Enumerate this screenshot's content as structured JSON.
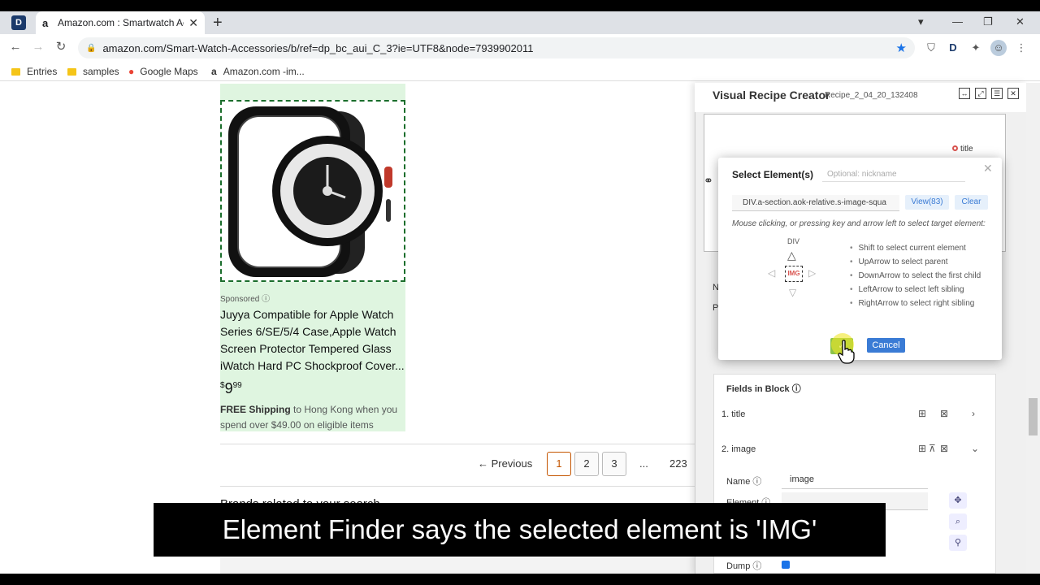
{
  "browser": {
    "tab_title": "Amazon.com : Smartwatch Ac",
    "tab_favicon": "a",
    "url": "amazon.com/Smart-Watch-Accessories/b/ref=dp_bc_aui_C_3?ie=UTF8&node=7939902011",
    "bookmarks": [
      {
        "label": "Entries",
        "icon": "folder-icon"
      },
      {
        "label": "samples",
        "icon": "folder-icon"
      },
      {
        "label": "Google Maps",
        "icon": "map-pin-icon"
      },
      {
        "label": "Amazon.com -im...",
        "icon": "amazon-icon"
      }
    ]
  },
  "product": {
    "sponsored": "Sponsored",
    "title": "Juyya Compatible for Apple Watch Series 6/SE/5/4 Case,Apple Watch Screen Protector Tempered Glass iWatch Hard PC Shockproof Cover...",
    "price_symbol": "$",
    "price_whole": "9",
    "price_fraction": "99",
    "shipping_bold": "FREE Shipping",
    "shipping_rest": " to Hong Kong when you spend over $49.00 on eligible items"
  },
  "pagination": {
    "previous": "← Previous",
    "pages": [
      "1",
      "2",
      "3"
    ],
    "ellipsis": "...",
    "last": "223"
  },
  "page": {
    "brands_heading": "Brands related to your search"
  },
  "recipe_panel": {
    "title": "Visual Recipe Creator",
    "subtitle": "Recipe_2_04_20_132408",
    "diagram_node": "title",
    "fields_heading": "Fields in Block",
    "fields": [
      {
        "label": "1. title"
      },
      {
        "label": "2. image"
      }
    ],
    "name_label": "Name",
    "name_value": "image",
    "element_label": "Element",
    "dump_label": "Dump"
  },
  "dialog": {
    "title": "Select Element(s)",
    "nickname_placeholder": "Optional: nickname",
    "selector": "DIV.a-section.aok-relative.s-image-squa",
    "view_label": "View(83)",
    "clear_label": "Clear",
    "hint": "Mouse clicking, or pressing key and arrow left to select target element:",
    "parent_tag": "DIV",
    "current_tag": "IMG",
    "shortcuts": [
      "Shift to select current element",
      "UpArrow to select parent",
      "DownArrow to select the first child",
      "LeftArrow to select left sibling",
      "RightArrow to select right sibling"
    ],
    "ok_label": "✓",
    "cancel_label": "Cancel"
  },
  "caption": "Element Finder says the selected element is 'IMG'",
  "colors": {
    "product_highlight": "#dff5e0",
    "accent_blue": "#3a7bd5",
    "active_page": "#c45500"
  }
}
